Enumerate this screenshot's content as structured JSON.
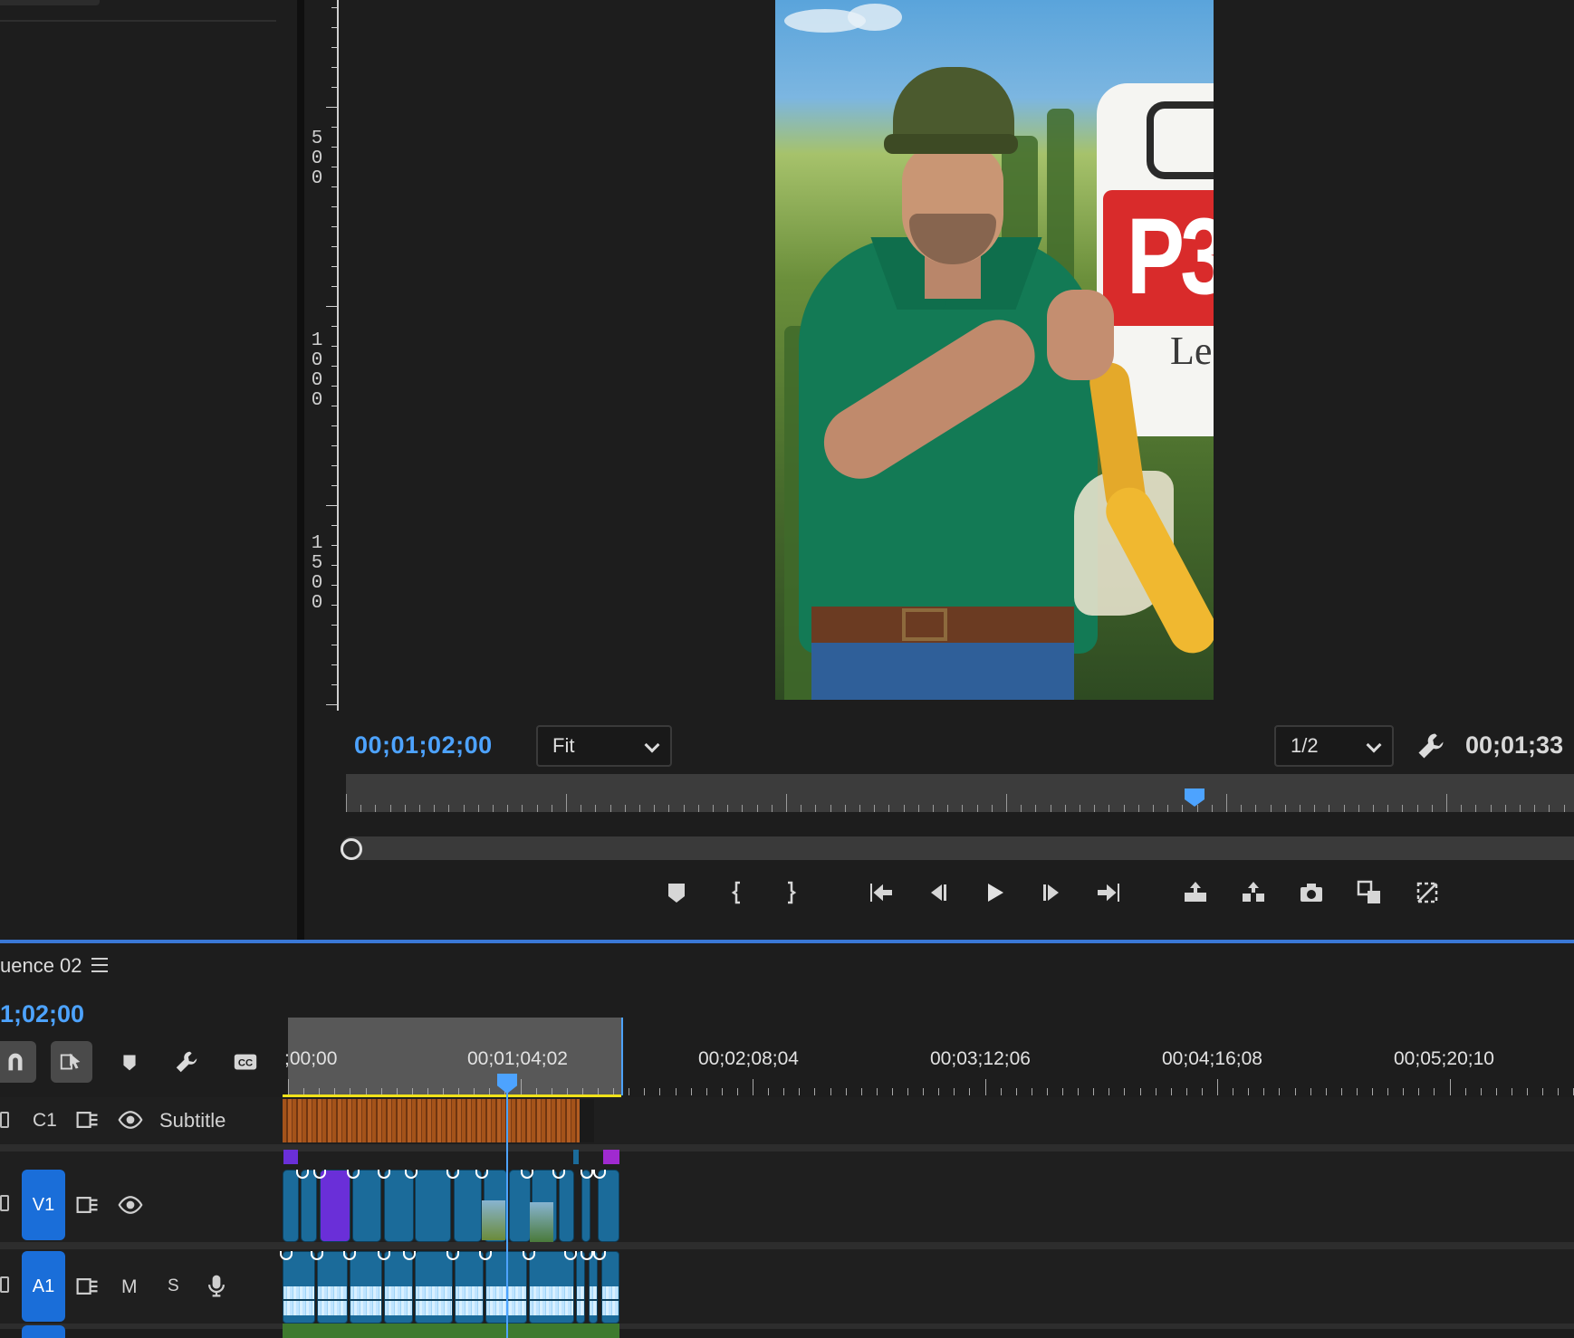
{
  "monitor": {
    "ruler_labels": [
      "500",
      "1000",
      "1500"
    ],
    "current_timecode": "00;01;02;00",
    "fit_label": "Fit",
    "resolution_label": "1/2",
    "duration_timecode": "00;01;33",
    "sign_text_brand": "P3",
    "sign_text_sub": "Le",
    "transport_icons": [
      "add-marker-icon",
      "mark-in-icon",
      "mark-out-icon",
      "go-to-in-icon",
      "step-back-icon",
      "play-icon",
      "step-forward-icon",
      "go-to-out-icon",
      "lift-icon",
      "extract-icon",
      "export-frame-icon",
      "comparison-view-icon",
      "proxy-toggle-icon"
    ]
  },
  "timeline": {
    "sequence_title": "uence 02",
    "current_timecode": "1;02;00",
    "ruler_labels": [
      ";00;00",
      "00;01;04;02",
      "00;02;08;04",
      "00;03;12;06",
      "00;04;16;08",
      "00;05;20;10"
    ],
    "tracks": {
      "c1": {
        "id": "C1",
        "name": "Subtitle"
      },
      "v1": {
        "id": "V1"
      },
      "a1": {
        "id": "A1",
        "mute": "M",
        "solo": "S"
      }
    }
  },
  "colors": {
    "accent_blue": "#4da3ff",
    "track_blue": "#1a6ed9",
    "clip_blue": "#1b6b9a",
    "caption_orange": "#a4531a",
    "purple_clip": "#6a2fd8",
    "work_area_yellow": "#f0e21a"
  }
}
